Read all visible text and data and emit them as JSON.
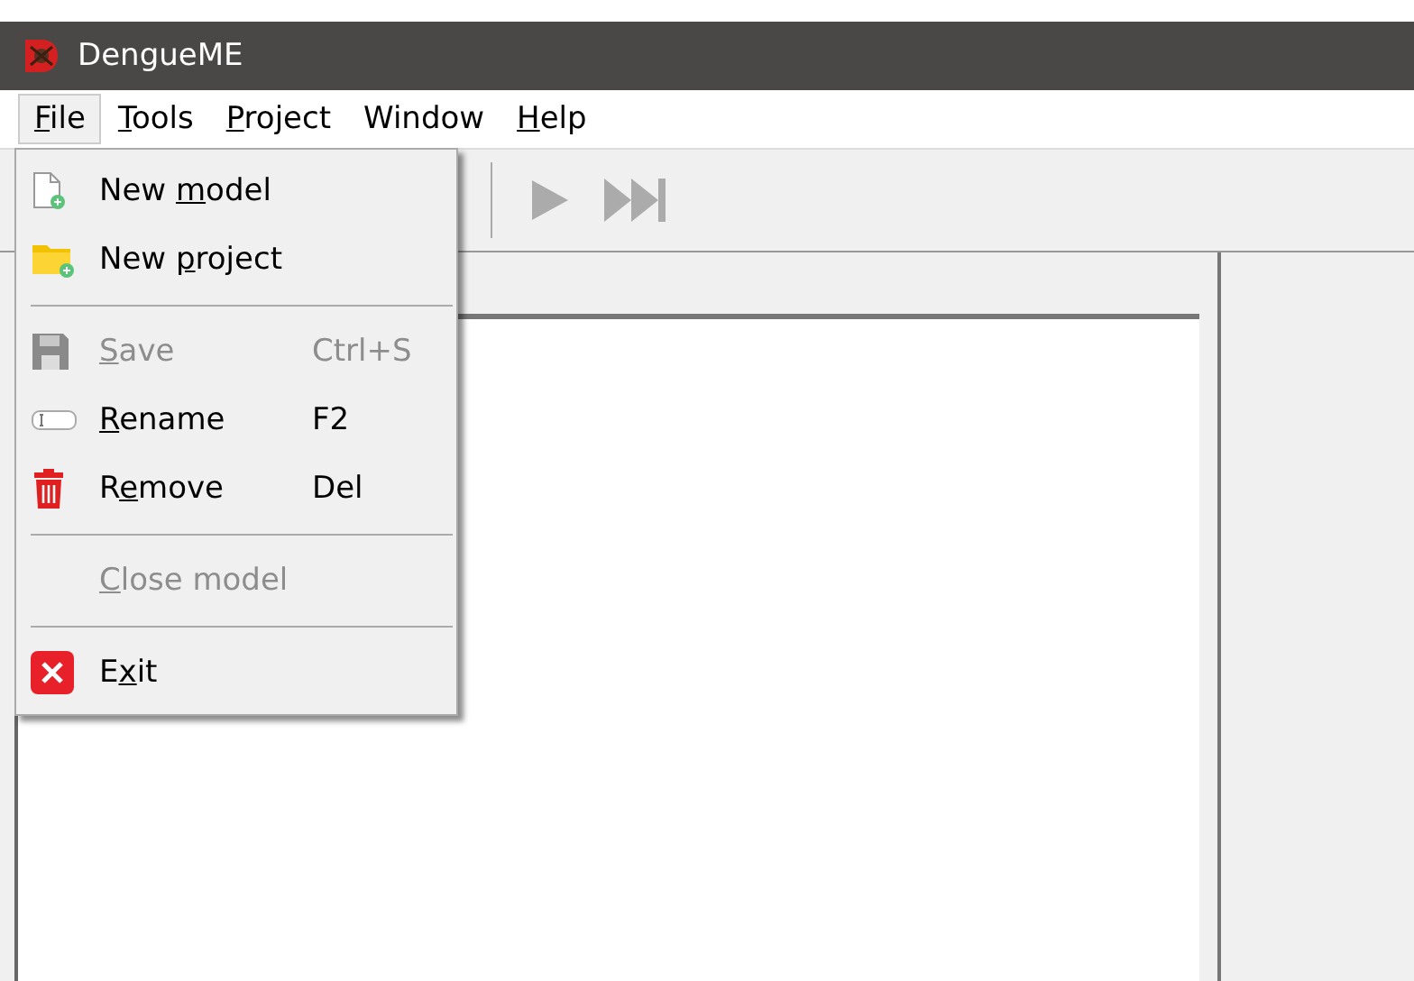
{
  "window": {
    "title": "DengueME"
  },
  "menubar": [
    {
      "key": "F",
      "post": "ile",
      "selected": true
    },
    {
      "key": "T",
      "post": "ools",
      "selected": false
    },
    {
      "key": "P",
      "post": "roject",
      "selected": false
    },
    {
      "pre": "Window",
      "selected": false
    },
    {
      "key": "H",
      "post": "elp",
      "selected": false
    }
  ],
  "toolbar": [
    {
      "kind": "play",
      "disabled": true
    },
    {
      "kind": "step",
      "disabled": true
    }
  ],
  "file_menu": [
    {
      "kind": "item",
      "pre": "New ",
      "key": "m",
      "post": "odel",
      "disabled": false
    },
    {
      "kind": "item",
      "pre": "New ",
      "key": "p",
      "post": "roject",
      "disabled": false
    },
    {
      "kind": "separator"
    },
    {
      "kind": "item",
      "key": "S",
      "post": "ave",
      "shortcut": "Ctrl+S",
      "disabled": true
    },
    {
      "kind": "item",
      "key": "R",
      "post": "ename",
      "shortcut": "F2",
      "disabled": false
    },
    {
      "kind": "item",
      "pre": "R",
      "key": "e",
      "post": "move",
      "shortcut": "Del",
      "disabled": false
    },
    {
      "kind": "separator"
    },
    {
      "kind": "item",
      "key": "C",
      "post": "lose model",
      "disabled": true
    },
    {
      "kind": "separator"
    },
    {
      "kind": "item",
      "pre": "E",
      "key": "x",
      "post": "it",
      "disabled": false
    }
  ]
}
